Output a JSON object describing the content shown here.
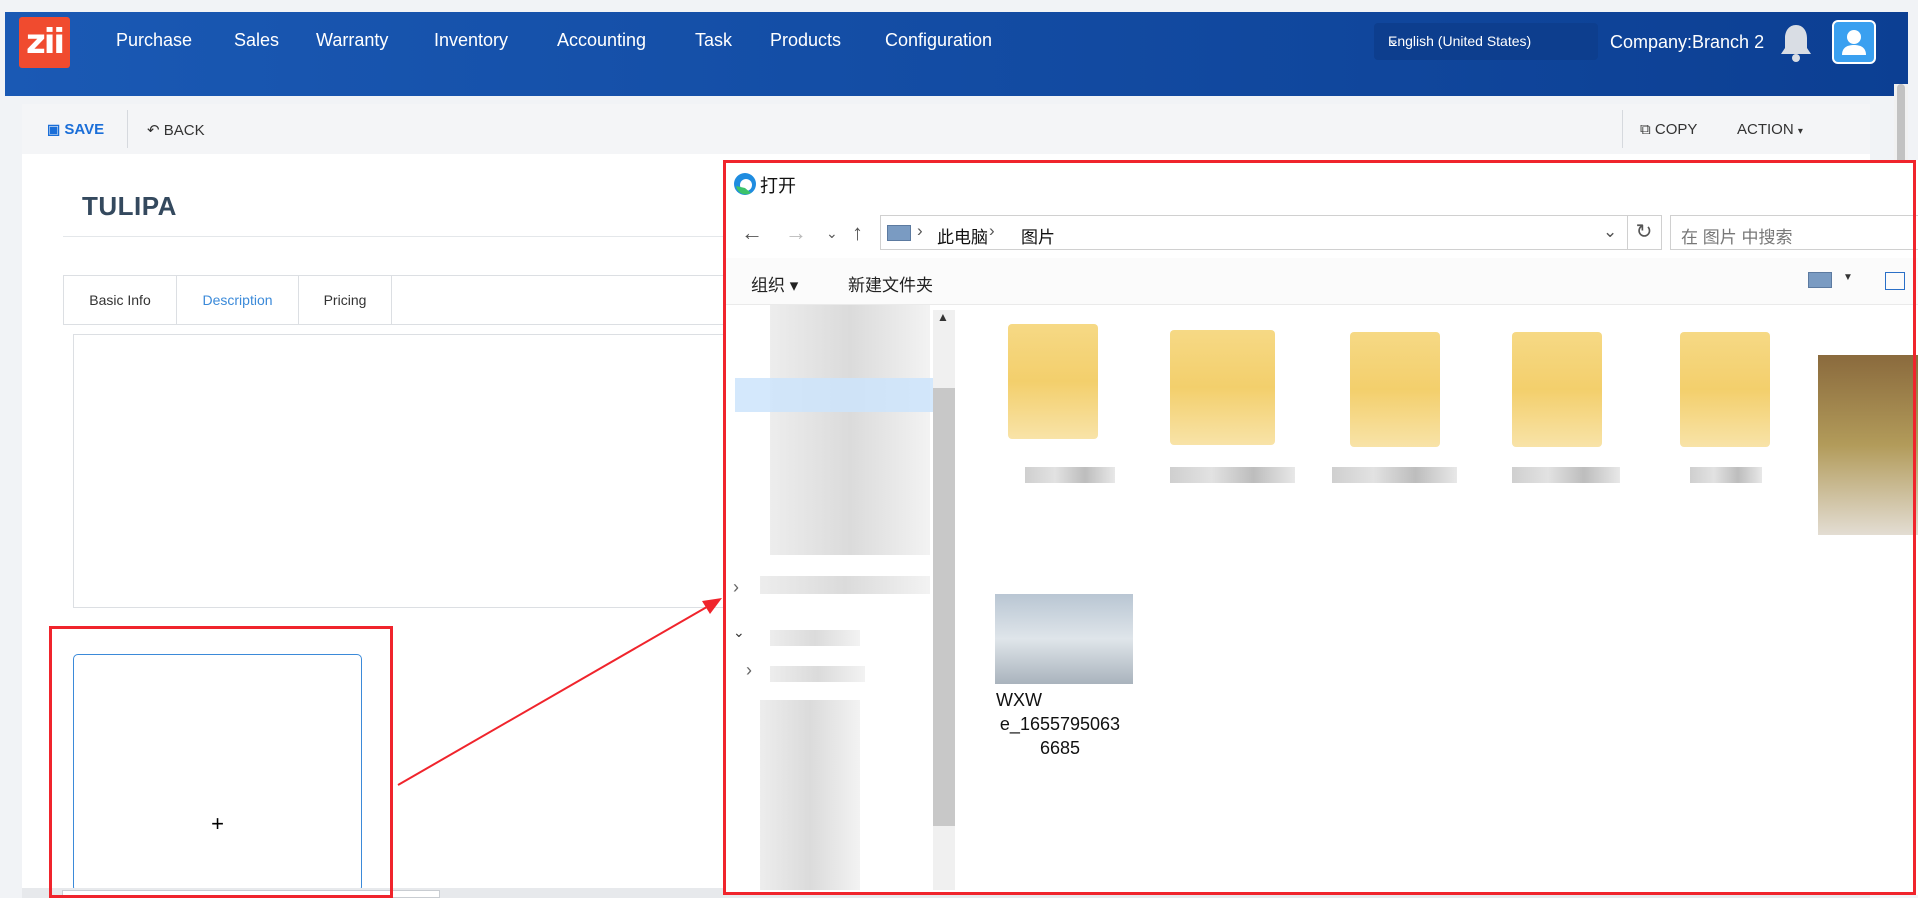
{
  "nav": {
    "logo_text": "zii",
    "items": [
      "Purchase",
      "Sales",
      "Warranty",
      "Inventory",
      "Accounting",
      "Task",
      "Products",
      "Configuration"
    ],
    "language": "English (United States)",
    "company": "Company:Branch 2"
  },
  "toolbar": {
    "save_label": "SAVE",
    "back_label": "BACK",
    "copy_label": "COPY",
    "action_label": "ACTION"
  },
  "record": {
    "title": "TULIPA"
  },
  "tabs": [
    "Basic Info",
    "Description",
    "Pricing"
  ],
  "active_tab": "Description",
  "upload": {
    "plus": "+"
  },
  "dialog": {
    "title": "打开",
    "breadcrumb": [
      "此电脑",
      "图片"
    ],
    "search_placeholder": "在 图片 中搜索",
    "organize_label": "组织 ▾",
    "new_folder_label": "新建文件夹",
    "file_name_lines": [
      "WXW",
      "e_1655795063",
      "6685"
    ]
  },
  "colors": {
    "nav_bg": "#0c3f93",
    "accent": "#3b8ad9",
    "annotation": "#f0242c",
    "logo": "#f04b2f"
  }
}
